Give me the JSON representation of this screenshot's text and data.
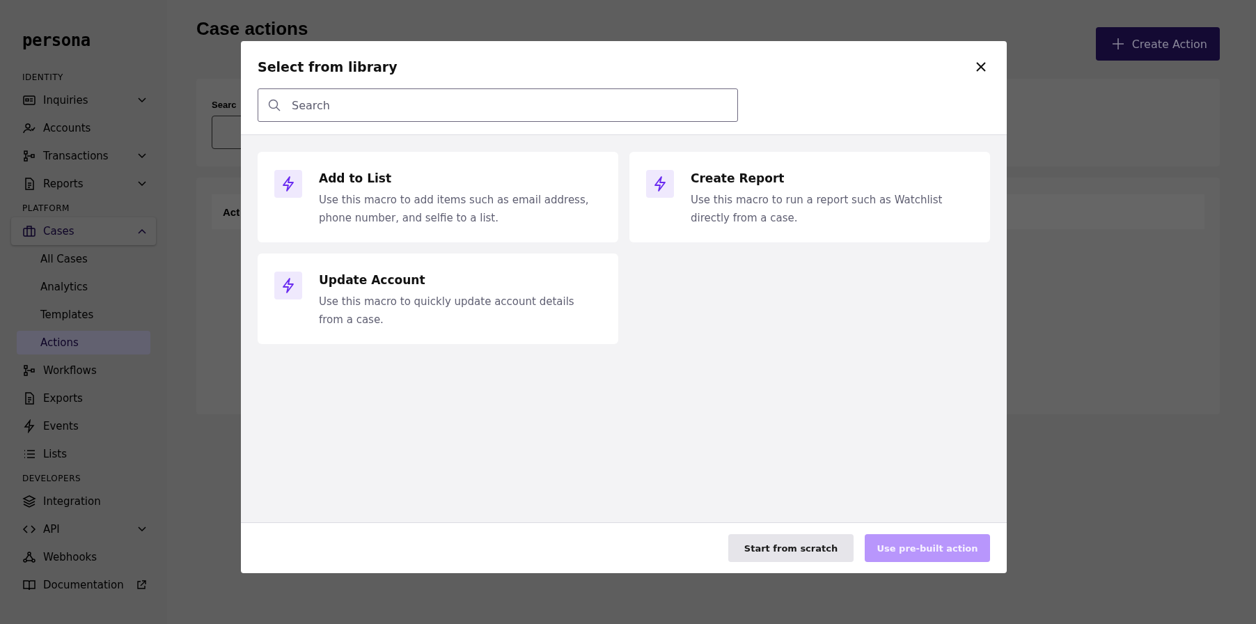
{
  "sidebar": {
    "logo": "persona",
    "sections": [
      {
        "heading": "IDENTITY",
        "items": [
          {
            "label": "Inquiries",
            "kind": "group",
            "expanded": false,
            "selected": false
          },
          {
            "label": "Accounts",
            "kind": "link",
            "selected": false
          },
          {
            "label": "Transactions",
            "kind": "group",
            "expanded": false,
            "selected": false
          },
          {
            "label": "Reports",
            "kind": "group",
            "expanded": false,
            "selected": false
          }
        ]
      },
      {
        "heading": "PLATFORM",
        "items": [
          {
            "label": "Cases",
            "kind": "group",
            "expanded": true,
            "selected": true,
            "children": [
              {
                "label": "All Cases",
                "selected": false
              },
              {
                "label": "Analytics",
                "selected": false
              },
              {
                "label": "Templates",
                "selected": false
              },
              {
                "label": "Actions",
                "selected": true
              }
            ]
          },
          {
            "label": "Workflows",
            "kind": "link",
            "selected": false
          },
          {
            "label": "Exports",
            "kind": "link",
            "selected": false
          },
          {
            "label": "Events",
            "kind": "link",
            "selected": false
          },
          {
            "label": "Lists",
            "kind": "link",
            "selected": false
          }
        ]
      },
      {
        "heading": "DEVELOPERS",
        "items": [
          {
            "label": "Integration",
            "kind": "link",
            "selected": false
          },
          {
            "label": "API",
            "kind": "group",
            "expanded": false,
            "selected": false
          },
          {
            "label": "Webhooks",
            "kind": "link",
            "selected": false
          },
          {
            "label": "Documentation",
            "kind": "external",
            "selected": false
          }
        ]
      }
    ]
  },
  "page": {
    "title": "Case actions",
    "create_button": "Create Action",
    "filter_label": "Searc",
    "table_header": "Act"
  },
  "modal": {
    "title": "Select from library",
    "search": {
      "placeholder": "Search"
    },
    "cards": [
      {
        "title": "Add to List",
        "description": "Use this macro to add items such as email address, phone number, and selfie to a list."
      },
      {
        "title": "Create Report",
        "description": "Use this macro to run a report such as Watchlist directly from a case."
      },
      {
        "title": "Update Account",
        "description": "Use this macro to quickly update account details from a case."
      }
    ],
    "buttons": [
      {
        "label": "Start from scratch",
        "kind": "secondary",
        "disabled": false
      },
      {
        "label": "Use pre-built action",
        "kind": "primary",
        "disabled": true
      }
    ]
  }
}
